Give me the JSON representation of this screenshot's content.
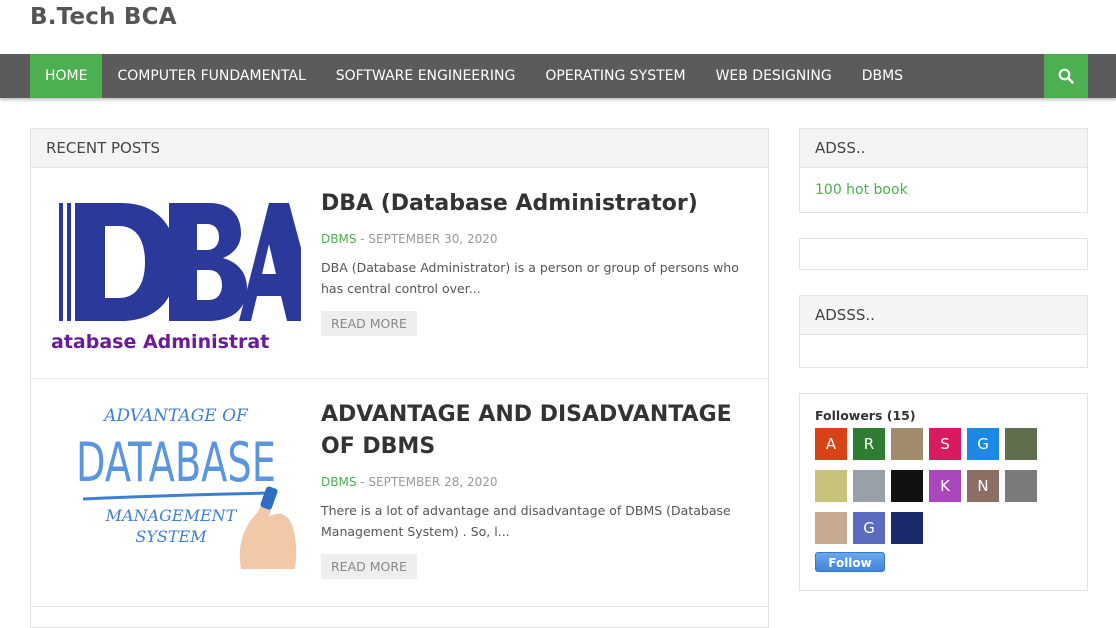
{
  "site": {
    "title": "B.Tech BCA"
  },
  "nav": {
    "items": [
      "HOME",
      "COMPUTER FUNDAMENTAL",
      "SOFTWARE ENGINEERING",
      "OPERATING SYSTEM",
      "WEB DESIGNING",
      "DBMS"
    ],
    "active_index": 0
  },
  "colors": {
    "accent": "#4caf50",
    "nav_bg": "#5b5b5b"
  },
  "recent": {
    "header": "RECENT POSTS",
    "posts": [
      {
        "title": "DBA (Database Administrator)",
        "category": "DBMS",
        "date": " - SEPTEMBER 30, 2020",
        "excerpt": "DBA (Database Administrator) is a person or group of persons who has central control over...",
        "read_more": "READ MORE",
        "thumb": {
          "big": "DBA",
          "caption": "atabase  Administrat"
        }
      },
      {
        "title": "ADVANTAGE AND DISADVANTAGE OF DBMS",
        "category": "DBMS",
        "date": " - SEPTEMBER 28, 2020",
        "excerpt": "There is a lot of advantage and disadvantage of DBMS (Database Management System) . So, l...",
        "read_more": "READ MORE",
        "thumb": {
          "line1": "ADVANTAGE OF",
          "line2": "DATABASE",
          "line3": "MANAGEMENT",
          "line4": "SYSTEM"
        }
      }
    ]
  },
  "sidebar": {
    "adss": {
      "title": "ADSS..",
      "link": "100 hot book"
    },
    "adsss": {
      "title": "ADSSS.."
    },
    "followers": {
      "title": "Followers (15)",
      "avatars": [
        {
          "letter": "A",
          "color": "#d84315"
        },
        {
          "letter": "R",
          "color": "#2e7d32"
        },
        {
          "letter": "",
          "color": "#a08b6c"
        },
        {
          "letter": "S",
          "color": "#d81b60"
        },
        {
          "letter": "G",
          "color": "#1e88e5"
        },
        {
          "letter": "",
          "color": "#5f6e4d"
        },
        {
          "letter": "",
          "color": "#c9c27a"
        },
        {
          "letter": "",
          "color": "#9aa0a8"
        },
        {
          "letter": "",
          "color": "#111111"
        },
        {
          "letter": "K",
          "color": "#ab47bc"
        },
        {
          "letter": "N",
          "color": "#8d6e63"
        },
        {
          "letter": "",
          "color": "#7b7b7b"
        },
        {
          "letter": "",
          "color": "#c8a88e"
        },
        {
          "letter": "G",
          "color": "#5c6bc0"
        },
        {
          "letter": "",
          "color": "#1a2a6c"
        }
      ],
      "follow_label": "Follow"
    }
  }
}
